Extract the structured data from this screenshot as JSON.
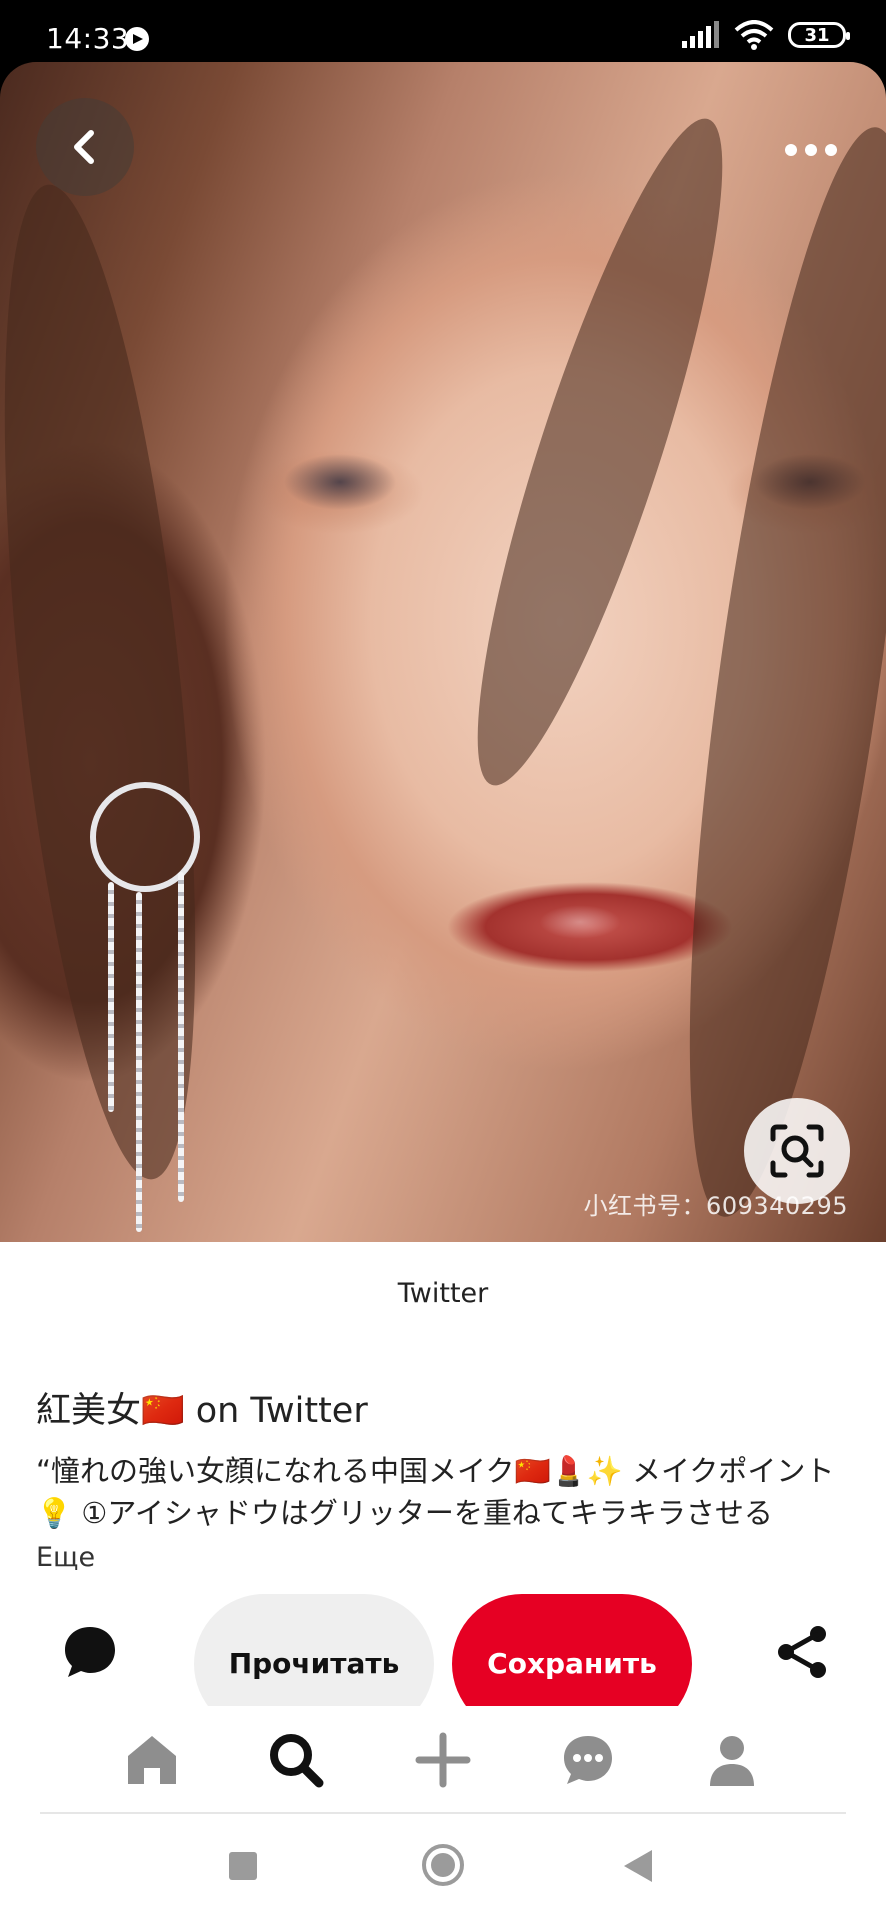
{
  "status_bar": {
    "time": "14:33",
    "battery": "31"
  },
  "pin": {
    "watermark": "小红书号：609340295",
    "source": "Twitter",
    "title": "紅美女🇨🇳 on Twitter",
    "description": "“憧れの強い女顔になれる中国メイク🇨🇳💄✨ メイクポイント💡 ①アイシャドウはグリッターを重ねてキラキラさせる",
    "more_label": "Еще"
  },
  "actions": {
    "read_label": "Прочитать",
    "save_label": "Сохранить"
  },
  "colors": {
    "accent": "#e60023",
    "read_bg": "#efefef"
  },
  "icons": [
    "back-icon",
    "more-icon",
    "visual-search-icon",
    "comment-icon",
    "share-icon",
    "home-icon",
    "search-icon",
    "plus-icon",
    "messages-icon",
    "profile-icon"
  ]
}
